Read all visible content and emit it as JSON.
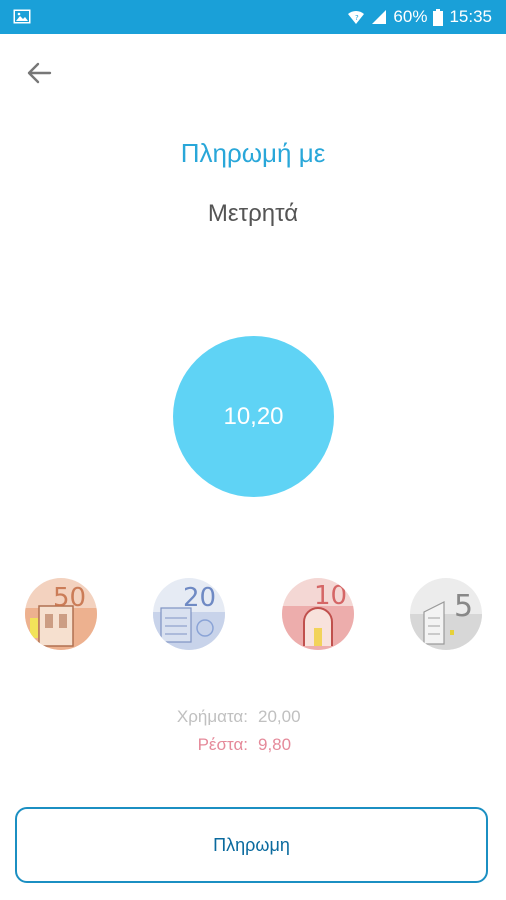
{
  "status_bar": {
    "battery": "60%",
    "time": "15:35",
    "icons": [
      "image-icon",
      "wifi-icon",
      "signal-icon",
      "battery-icon"
    ]
  },
  "header": {
    "back_icon": "back-arrow-icon"
  },
  "payment": {
    "title": "Πληρωμή με",
    "method": "Μετρητά",
    "amount": "10,20"
  },
  "notes": [
    {
      "value": "50",
      "color": "#e9a37a"
    },
    {
      "value": "20",
      "color": "#8aa3d6"
    },
    {
      "value": "10",
      "color": "#e88a8a"
    },
    {
      "value": "5",
      "color": "#a8a8a8"
    }
  ],
  "summary": {
    "money_label": "Χρήματα:",
    "money_value": "20,00",
    "change_label": "Ρέστα:",
    "change_value": "9,80",
    "money_color": "#c0c0c0",
    "change_color": "#e58a9a"
  },
  "pay_button": {
    "label": "Πληρωμη"
  },
  "colors": {
    "status_bar": "#1aa0d8",
    "accent": "#29a7d9",
    "amount_circle": "#5fd3f5"
  }
}
